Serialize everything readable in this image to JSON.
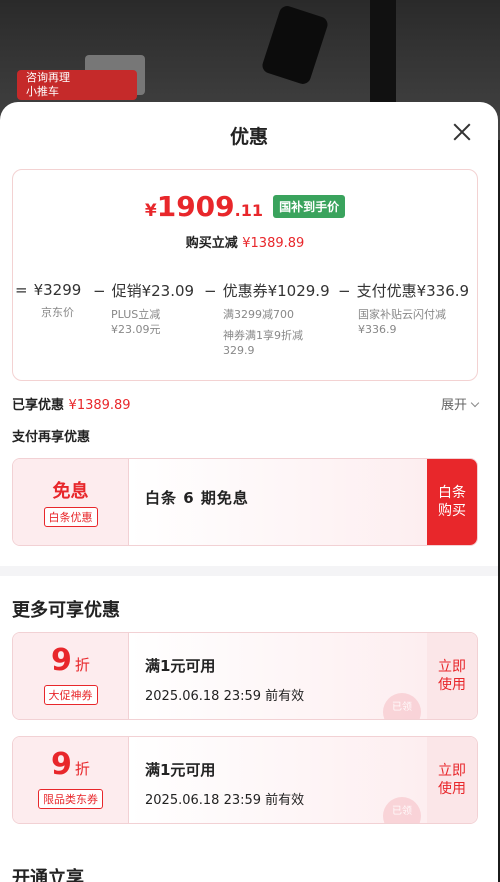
{
  "background": {
    "tag_line1": "咨询再理",
    "tag_line2": "小推车"
  },
  "sheet": {
    "title": "优惠"
  },
  "price": {
    "currency": "¥",
    "integer": "1909",
    "decimal": ".11",
    "badge": "国补到手价",
    "reduce_label": "购买立减",
    "reduce_value": "¥1389.89"
  },
  "calc": [
    {
      "op": "=",
      "amount": "¥3299",
      "sub1": "京东价",
      "sub2": ""
    },
    {
      "op": "−",
      "amount": "促销¥23.09",
      "sub1": "PLUS立减",
      "sub2": "¥23.09元"
    },
    {
      "op": "−",
      "amount": "优惠券¥1029.9",
      "sub1": "满3299减700",
      "sub2": "神券满1享9折减",
      "sub3": "329.9"
    },
    {
      "op": "−",
      "amount": "支付优惠¥336.9",
      "sub1": "国家补贴云闪付减",
      "sub2": "¥336.9"
    }
  ],
  "enjoyed": {
    "label": "已享优惠",
    "value": "¥1389.89",
    "expand": "展开"
  },
  "pay_section": {
    "title": "支付再享优惠",
    "coupon": {
      "big": "免息",
      "tag": "白条优惠",
      "text": "白条 6 期免息",
      "action_line1": "白条",
      "action_line2": "购买"
    }
  },
  "more_section": {
    "title": "更多可享优惠",
    "coupons": [
      {
        "num": "9",
        "unit": "折",
        "tag": "大促神券",
        "line1": "满1元可用",
        "line2": "2025.06.18 23:59 前有效",
        "action_line1": "立即",
        "action_line2": "使用",
        "stamp": "已领"
      },
      {
        "num": "9",
        "unit": "折",
        "tag": "限品类东券",
        "line1": "满1元可用",
        "line2": "2025.06.18 23:59 前有效",
        "action_line1": "立即",
        "action_line2": "使用",
        "stamp": "已领"
      }
    ]
  },
  "next_section": {
    "title": "开通立享"
  },
  "colors": {
    "accent_red": "#e8272b",
    "badge_green": "#3aa35d"
  }
}
